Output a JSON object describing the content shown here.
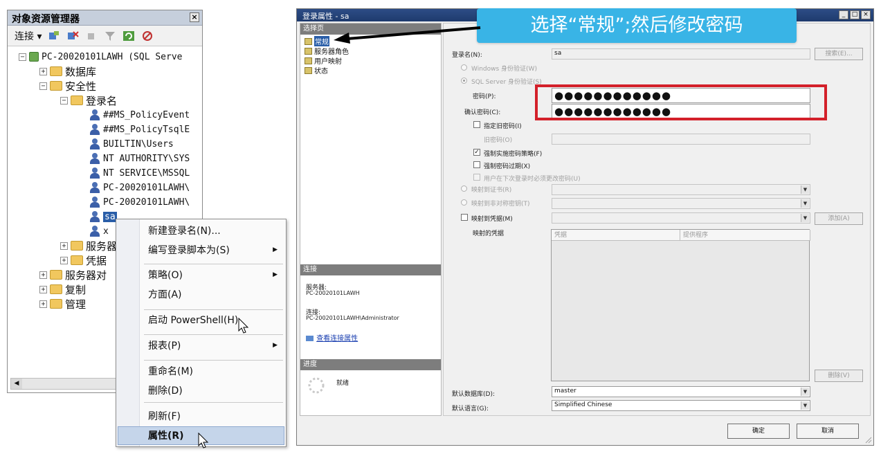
{
  "object_explorer": {
    "title": "对象资源管理器",
    "close": "×",
    "toolbar": {
      "connect_label": "连接 ▾"
    },
    "tree": [
      {
        "text": "PC-20020101LAWH (SQL Serve",
        "level": 0,
        "expander": "−",
        "icon": "server-icon"
      },
      {
        "text": "数据库",
        "level": 1,
        "expander": "+",
        "icon": "folder-icon"
      },
      {
        "text": "安全性",
        "level": 1,
        "expander": "−",
        "icon": "folder-icon"
      },
      {
        "text": "登录名",
        "level": 2,
        "expander": "−",
        "icon": "folder-icon"
      },
      {
        "text": "##MS_PolicyEvent",
        "level": 3,
        "expander": "",
        "icon": "user-icon"
      },
      {
        "text": "##MS_PolicyTsqlE",
        "level": 3,
        "expander": "",
        "icon": "user-icon"
      },
      {
        "text": "BUILTIN\\Users",
        "level": 3,
        "expander": "",
        "icon": "group-icon"
      },
      {
        "text": "NT AUTHORITY\\SYS",
        "level": 3,
        "expander": "",
        "icon": "group-icon"
      },
      {
        "text": "NT SERVICE\\MSSQL",
        "level": 3,
        "expander": "",
        "icon": "group-icon"
      },
      {
        "text": "PC-20020101LAWH\\",
        "level": 3,
        "expander": "",
        "icon": "user-icon"
      },
      {
        "text": "PC-20020101LAWH\\",
        "level": 3,
        "expander": "",
        "icon": "user-icon"
      },
      {
        "text": "sa",
        "level": 3,
        "expander": "",
        "icon": "user-icon",
        "selected": true
      },
      {
        "text": "x",
        "level": 3,
        "expander": "",
        "icon": "user-icon"
      },
      {
        "text": "服务器",
        "level": 2,
        "expander": "+",
        "icon": "folder-icon"
      },
      {
        "text": "凭据",
        "level": 2,
        "expander": "+",
        "icon": "folder-icon"
      },
      {
        "text": "服务器对",
        "level": 1,
        "expander": "+",
        "icon": "folder-icon"
      },
      {
        "text": "复制",
        "level": 1,
        "expander": "+",
        "icon": "folder-icon"
      },
      {
        "text": "管理",
        "level": 1,
        "expander": "+",
        "icon": "folder-icon"
      }
    ]
  },
  "context_menu": {
    "items": [
      {
        "label": "新建登录名(N)...",
        "submenu": false
      },
      {
        "label": "编写登录脚本为(S)",
        "submenu": true
      },
      {
        "label": "策略(O)",
        "submenu": true
      },
      {
        "label": "方面(A)",
        "submenu": false
      },
      {
        "label": "启动 PowerShell(H)",
        "submenu": false
      },
      {
        "label": "报表(P)",
        "submenu": true
      },
      {
        "label": "重命名(M)",
        "submenu": false
      },
      {
        "label": "删除(D)",
        "submenu": false
      },
      {
        "label": "刷新(F)",
        "submenu": false
      },
      {
        "label": "属性(R)",
        "submenu": false,
        "highlighted": true
      }
    ]
  },
  "dialog": {
    "title": "登录属性 - sa",
    "window_buttons": [
      "_",
      "□",
      "×"
    ],
    "select_page_header": "选择页",
    "pages": [
      "常规",
      "服务器角色",
      "用户映射",
      "状态"
    ],
    "connection_header": "连接",
    "server_label": "服务器:",
    "server_value": "PC-20020101LAWH",
    "connection_label": "连接:",
    "connection_value": "PC-20020101LAWH\\Administrator",
    "view_connection_link": "查看连接属性",
    "progress_header": "进度",
    "progress_status": "就绪",
    "general": {
      "login_name_label": "登录名(N):",
      "login_name_value": "sa",
      "search_button": "搜索(E)...",
      "windows_auth_label": "Windows 身份验证(W)",
      "sql_auth_label": "SQL Server 身份验证(S)",
      "password_label": "密码(P):",
      "password_value": "●●●●●●●●●●●●",
      "confirm_password_label": "确认密码(C):",
      "confirm_password_value": "●●●●●●●●●●●●",
      "specify_old_password_label": "指定旧密码(I)",
      "old_password_label": "旧密码(O)",
      "enforce_policy_label": "强制实施密码策略(F)",
      "enforce_expiration_label": "强制密码过期(X)",
      "must_change_label": "用户在下次登录时必须更改密码(U)",
      "map_certificate_label": "映射到证书(R)",
      "map_asymmetric_label": "映射到非对称密钥(T)",
      "map_credential_label": "映射到凭据(M)",
      "add_button": "添加(A)",
      "mapped_credentials_label": "映射的凭据",
      "grid_col_credential": "凭据",
      "grid_col_provider": "提供程序",
      "remove_button": "删除(V)",
      "default_db_label": "默认数据库(D):",
      "default_db_value": "master",
      "default_lang_label": "默认语言(G):",
      "default_lang_value": "Simplified Chinese"
    },
    "ok_button": "确定",
    "cancel_button": "取消"
  },
  "callout": {
    "text": "选择“常规”;然后修改密码",
    "color": "#39b4e6"
  },
  "highlight_color": "#d3202a"
}
